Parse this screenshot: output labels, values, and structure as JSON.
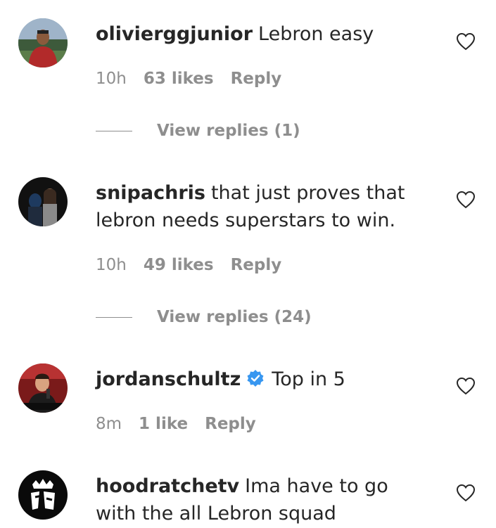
{
  "comments": [
    {
      "username": "oliviergg junior",
      "username_display": "olivierggjunior",
      "text": "Lebron easy",
      "time": "10h",
      "likes": "63 likes",
      "reply": "Reply",
      "view_replies": "View replies (1)",
      "avatar_icon": "profile-photo-man-outdoors"
    },
    {
      "username_display": "snipachris",
      "text": "that just proves that lebron needs superstars to win.",
      "time": "10h",
      "likes": "49 likes",
      "reply": "Reply",
      "view_replies": "View replies (24)",
      "avatar_icon": "profile-photo-couple"
    },
    {
      "username_display": "jordanschultz",
      "verified": true,
      "text": "Top in 5",
      "time": "8m",
      "likes": "1 like",
      "reply": "Reply",
      "avatar_icon": "profile-photo-broadcaster"
    },
    {
      "username_display": "hoodratchetv",
      "text": "Ima have to go with the all Lebron squad",
      "avatar_icon": "hood-logo"
    }
  ],
  "colors": {
    "text": "#262626",
    "secondary": "#8e8e8e",
    "verified_blue": "#3897f0"
  },
  "icons": {
    "like": "heart-outline-icon",
    "verified": "verified-badge-icon"
  }
}
